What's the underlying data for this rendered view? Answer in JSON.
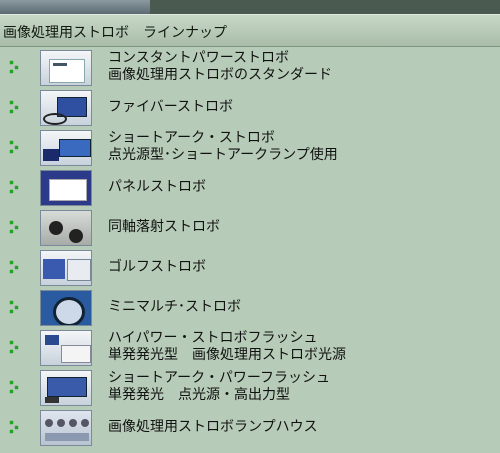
{
  "header": {
    "title": "画像処理用ストロボ　ラインナップ"
  },
  "items": [
    {
      "line1": "コンスタントパワーストロボ",
      "line2": "画像処理用ストロボのスタンダード"
    },
    {
      "line1": "ファイバーストロボ",
      "line2": ""
    },
    {
      "line1": "ショートアーク・ストロボ",
      "line2": "点光源型･ショートアークランプ使用"
    },
    {
      "line1": "パネルストロボ",
      "line2": ""
    },
    {
      "line1": "同軸落射ストロボ",
      "line2": ""
    },
    {
      "line1": "ゴルフストロボ",
      "line2": ""
    },
    {
      "line1": "ミニマルチ･ストロボ",
      "line2": ""
    },
    {
      "line1": "ハイパワー・ストロボフラッシュ",
      "line2": "単発発光型　画像処理用ストロボ光源"
    },
    {
      "line1": "ショートアーク・パワーフラッシュ",
      "line2": "単発発光　点光源・高出力型"
    },
    {
      "line1": "画像処理用ストロボランプハウス",
      "line2": ""
    }
  ]
}
